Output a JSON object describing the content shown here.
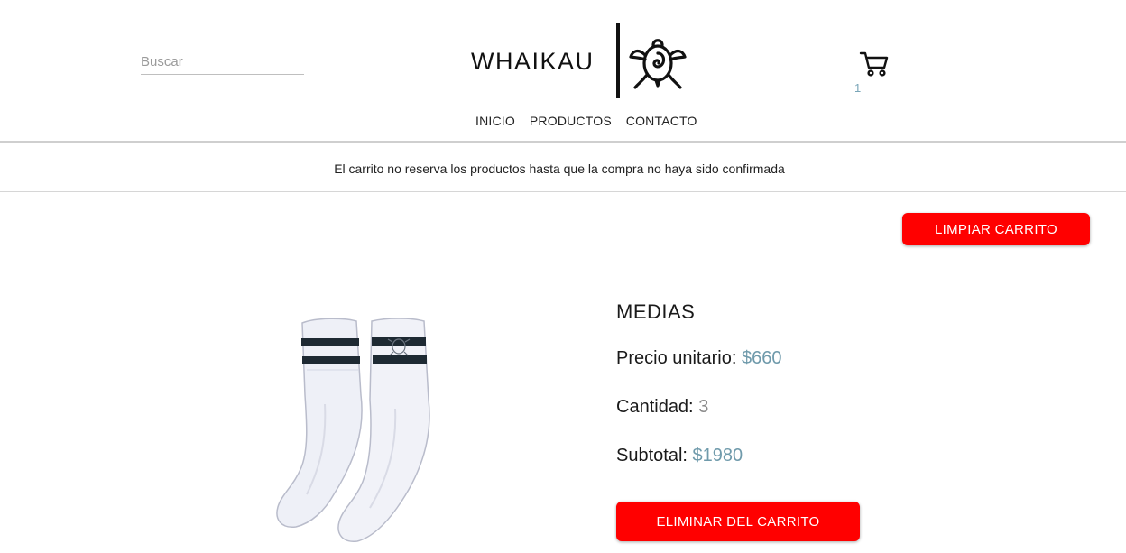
{
  "header": {
    "search_placeholder": "Buscar",
    "logo_text": "WHAIKAU",
    "cart_count": "1"
  },
  "nav": {
    "items": [
      "INICIO",
      "PRODUCTOS",
      "CONTACTO"
    ]
  },
  "notice": "El carrito no reserva los productos hasta que la compra no haya sido confirmada",
  "actions": {
    "clear_cart_label": "LIMPIAR CARRITO"
  },
  "cart_item": {
    "name": "MEDIAS",
    "price_label": "Precio unitario:",
    "price_value": "$660",
    "qty_label": "Cantidad:",
    "qty_value": "3",
    "subtotal_label": "Subtotal:",
    "subtotal_value": "$1980",
    "remove_label": "ELIMINAR DEL CARRITO"
  },
  "colors": {
    "accent_red": "#ff0000",
    "value_blue": "#6f9aab"
  },
  "icons": [
    "turtle-logo-icon",
    "cart-icon"
  ]
}
